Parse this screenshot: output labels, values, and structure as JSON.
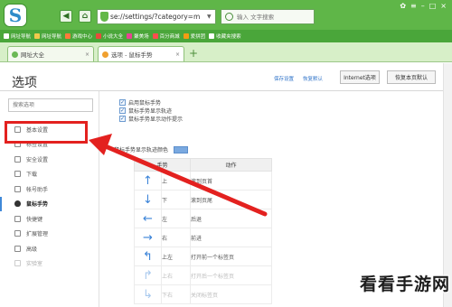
{
  "browser": {
    "logo_letter": "S",
    "url": "se://settings/?category=m",
    "search_placeholder": "输入 文字搜索",
    "bookmarks": [
      "网址导航",
      "网址导航",
      "游戏中心",
      "小说大全",
      "聚美场",
      "百分商城",
      "爱拼团",
      "收藏夹搜索"
    ],
    "tabs": [
      {
        "label": "网址大全",
        "close": "×"
      },
      {
        "label": "选项 - 鼠标手势",
        "close": "×"
      }
    ],
    "newtab": "+"
  },
  "page": {
    "title": "选项",
    "links": [
      "保存设置",
      "恢复默认"
    ],
    "internet_options_button": "Internet选项",
    "restore_default_button": "恢复本页默认"
  },
  "sidebar": {
    "search_placeholder": "搜索选项",
    "items": [
      {
        "label": "基本设置",
        "state": "normal"
      },
      {
        "label": "标签设置",
        "state": "normal"
      },
      {
        "label": "安全设置",
        "state": "normal"
      },
      {
        "label": "下载",
        "state": "normal"
      },
      {
        "label": "帐号助手",
        "state": "normal"
      },
      {
        "label": "鼠标手势",
        "state": "selected"
      },
      {
        "label": "快捷键",
        "state": "normal"
      },
      {
        "label": "扩展管理",
        "state": "normal"
      },
      {
        "label": "高级",
        "state": "normal"
      },
      {
        "label": "实验室",
        "state": "faded"
      }
    ]
  },
  "gestures": {
    "options": [
      {
        "label": "启用鼠标手势",
        "checked": true
      },
      {
        "label": "鼠标手势显示轨迹",
        "checked": true
      },
      {
        "label": "鼠标手势显示动作提示",
        "checked": true
      }
    ],
    "trail_color_label": "鼠标手势显示轨迹颜色",
    "trail_color": "#7aa9e0",
    "table_headers": [
      "手势",
      "动作"
    ],
    "rows": [
      {
        "arrow": "↑",
        "direction": "上",
        "action": "滚到页首",
        "faded": false
      },
      {
        "arrow": "↓",
        "direction": "下",
        "action": "滚到页尾",
        "faded": false
      },
      {
        "arrow": "←",
        "direction": "左",
        "action": "后退",
        "faded": false
      },
      {
        "arrow": "→",
        "direction": "右",
        "action": "前进",
        "faded": false
      },
      {
        "arrow": "↰",
        "direction": "上左",
        "action": "打开前一个标签页",
        "faded": false
      },
      {
        "arrow": "↱",
        "direction": "上右",
        "action": "打开后一个标签页",
        "faded": true
      },
      {
        "arrow": "↳",
        "direction": "下右",
        "action": "关闭标签页",
        "faded": true
      }
    ]
  },
  "annotation_color": "#e3211f",
  "watermark": "看看手游网"
}
